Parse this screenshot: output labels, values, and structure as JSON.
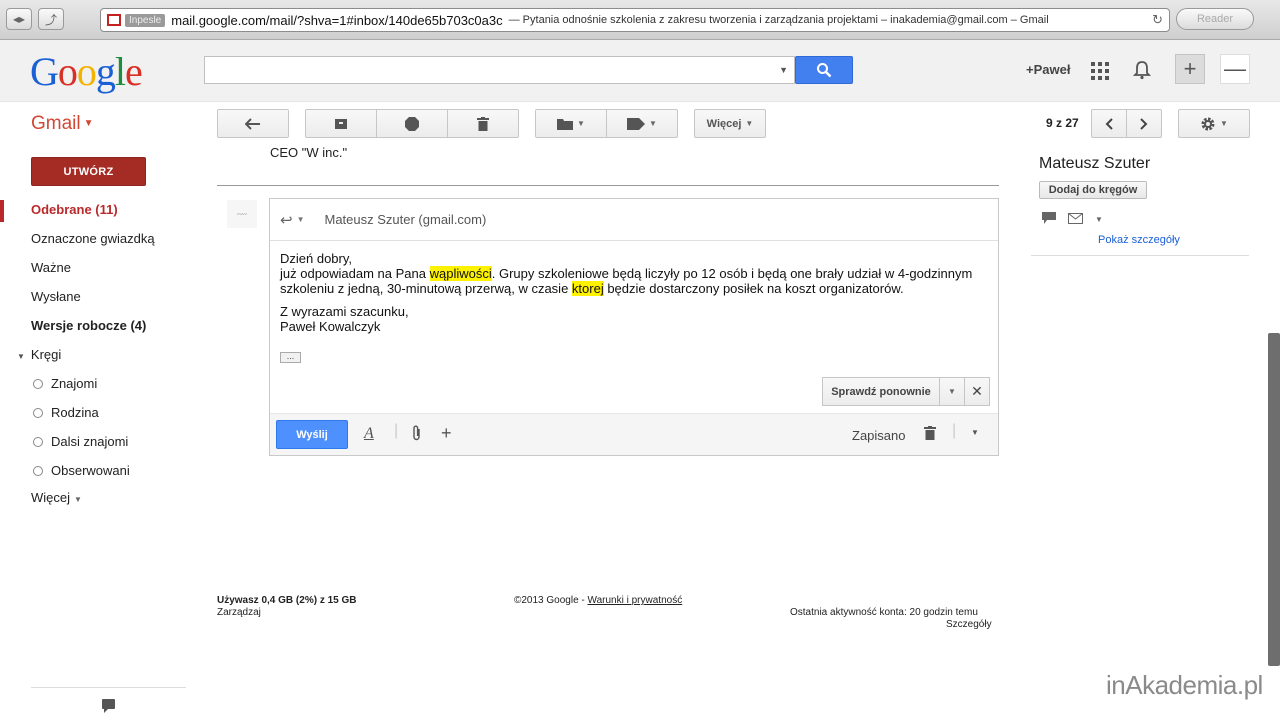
{
  "browser": {
    "badge": "Inpesle",
    "url": "mail.google.com/mail/?shva=1#inbox/140de65b703c0a3c",
    "title": "— Pytania odnośnie szkolenia z zakresu tworzenia i zarządzania projektami – inakademia@gmail.com – Gmail",
    "reader_label": "Reader"
  },
  "header": {
    "logo": [
      "G",
      "o",
      "o",
      "g",
      "l",
      "e"
    ],
    "plus_user": "+Paweł"
  },
  "toolbar": {
    "gmail_label": "Gmail",
    "more_label": "Więcej",
    "pager": "9 z 27"
  },
  "nav": {
    "compose": "UTWÓRZ",
    "items": [
      {
        "label": "Odebrane (11)"
      },
      {
        "label": "Oznaczone gwiazdką"
      },
      {
        "label": "Ważne"
      },
      {
        "label": "Wysłane"
      },
      {
        "label": "Wersje robocze (4)"
      },
      {
        "label": "Kręgi"
      }
    ],
    "circles": [
      {
        "label": "Znajomi"
      },
      {
        "label": "Rodzina"
      },
      {
        "label": "Dalsi znajomi"
      },
      {
        "label": "Obserwowani"
      }
    ],
    "more": "Więcej"
  },
  "message": {
    "prev_signature": "CEO \"W inc.\"",
    "reply_to": "Mateusz Szuter (gmail.com)",
    "greeting": "Dzień dobry,",
    "line1_a": "już odpowiadam na Pana ",
    "line1_mark": "wąpliwości",
    "line1_b": ". Grupy szkoleniowe będą liczyły po 12 osób i będą one brały udział w 4-godzinnym",
    "line2_a": "szkoleniu z jedną, 30-minutową przerwą, w czasie ",
    "line2_mark": "ktorej",
    "line2_b": " będzie dostarczony posiłek na koszt organizatorów.",
    "closing": "Z wyrazami szacunku,",
    "signature": "Paweł Kowalczyk",
    "ellipsis": "...",
    "spellcheck": "Sprawdź ponownie",
    "send": "Wyślij",
    "saved": "Zapisano"
  },
  "profile": {
    "name": "Mateusz Szuter",
    "add_button": "Dodaj do kręgów",
    "details_link": "Pokaż szczegóły"
  },
  "footer": {
    "storage": "Używasz 0,4 GB (2%) z 15 GB",
    "manage": "Zarządzaj",
    "copyright": "©2013 Google - ",
    "terms": "Warunki i prywatność",
    "activity": "Ostatnia aktywność konta: 20 godzin temu",
    "details": "Szczegóły"
  },
  "watermark": "inAkademia.pl",
  "colors": {
    "accent_red": "#d14836",
    "compose_bg": "#a52c25",
    "send_blue": "#4d90fe",
    "highlight": "#fff200"
  }
}
